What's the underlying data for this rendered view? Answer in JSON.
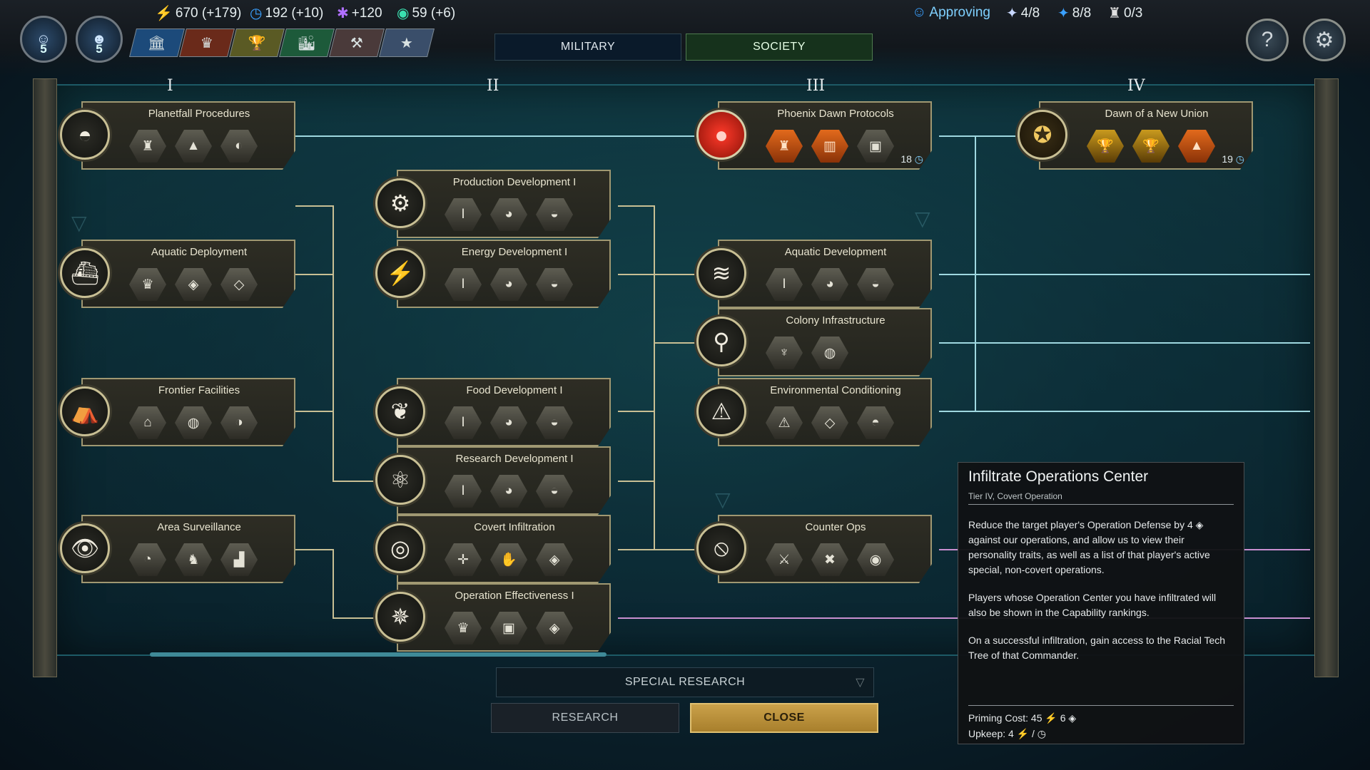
{
  "top": {
    "avatars": [
      {
        "level": "5"
      },
      {
        "level": "5"
      }
    ],
    "resources": {
      "energy": "670 (+179)",
      "influence": "192 (+10)",
      "research": "+120",
      "signal": "59 (+6)",
      "approval": "Approving",
      "op1": "4/8",
      "op2": "8/8",
      "op3": "0/3"
    },
    "chips": [
      "🏛",
      "♛",
      "🏆",
      "🏙",
      "⚒",
      "★"
    ],
    "tabs": {
      "military": "MILITARY",
      "society": "SOCIETY"
    },
    "help_icon": "?",
    "settings_icon": "⚙"
  },
  "columns": [
    "I",
    "II",
    "III",
    "IV"
  ],
  "nodes": {
    "planetfall": {
      "title": "Planetfall Procedures",
      "icon": "◓",
      "slots": [
        "♜",
        "▲",
        "◐"
      ]
    },
    "aquatic_deployment": {
      "title": "Aquatic Deployment",
      "icon": "⛴",
      "slots": [
        "♛",
        "◈",
        "◇"
      ]
    },
    "frontier": {
      "title": "Frontier Facilities",
      "icon": "⛺",
      "slots": [
        "⌂",
        "◍",
        "◑"
      ]
    },
    "area_surveillance": {
      "title": "Area Surveillance",
      "icon": "👁",
      "slots": [
        "◔",
        "♞",
        "▟"
      ]
    },
    "production_dev": {
      "title": "Production Development I",
      "icon": "⚙",
      "slots": [
        "I",
        "◕",
        "◒"
      ]
    },
    "energy_dev": {
      "title": "Energy Development I",
      "icon": "⚡",
      "slots": [
        "I",
        "◕",
        "◒"
      ]
    },
    "food_dev": {
      "title": "Food Development I",
      "icon": "❦",
      "slots": [
        "I",
        "◕",
        "◒"
      ]
    },
    "research_dev": {
      "title": "Research Development I",
      "icon": "⚛",
      "slots": [
        "I",
        "◕",
        "◒"
      ]
    },
    "covert_infiltration": {
      "title": "Covert Infiltration",
      "icon": "◎",
      "slots": [
        "✛",
        "✋",
        "◈"
      ]
    },
    "operation_effectiveness": {
      "title": "Operation Effectiveness I",
      "icon": "✵",
      "slots": [
        "♛",
        "▣",
        "◈"
      ]
    },
    "phoenix": {
      "title": "Phoenix Dawn Protocols",
      "icon": "●",
      "slots": [
        "♜",
        "▥",
        "▣"
      ],
      "turns": "18"
    },
    "aquatic_development": {
      "title": "Aquatic Development",
      "icon": "≋",
      "slots": [
        "I",
        "◕",
        "◒"
      ]
    },
    "colony_infra": {
      "title": "Colony Infrastructure",
      "icon": "⚲",
      "slots": [
        "♆",
        "◍"
      ]
    },
    "env_conditioning": {
      "title": "Environmental Conditioning",
      "icon": "⚠",
      "slots": [
        "⚠",
        "◇",
        "◓"
      ]
    },
    "counter_ops": {
      "title": "Counter Ops",
      "icon": "⦸",
      "slots": [
        "⚔",
        "✖",
        "◉"
      ]
    },
    "dawn_union": {
      "title": "Dawn of a New Union",
      "icon": "✪",
      "slots": [
        "🏆",
        "🏆",
        "▲"
      ],
      "turns": "19"
    }
  },
  "tooltip": {
    "title": "Infiltrate Operations Center",
    "subtitle": "Tier IV, Covert Operation",
    "p1": "Reduce the target player's Operation Defense by 4 ◈ against our operations, and allow us to view their personality traits, as well as a list of that player's active special, non-covert operations.",
    "p2": "Players whose Operation Center you have infiltrated will also be shown in the Capability rankings.",
    "p3": "On a successful infiltration, gain access to the Racial Tech Tree of that Commander.",
    "priming": "Priming Cost: 45 ⚡ 6 ◈",
    "upkeep": "Upkeep: 4 ⚡ / ◷"
  },
  "bottom": {
    "special": "SPECIAL RESEARCH",
    "research": "RESEARCH",
    "close": "CLOSE"
  },
  "colors": {
    "accent": "#c8bf94",
    "close": "#caa14a",
    "line": "#9fd8e0"
  }
}
